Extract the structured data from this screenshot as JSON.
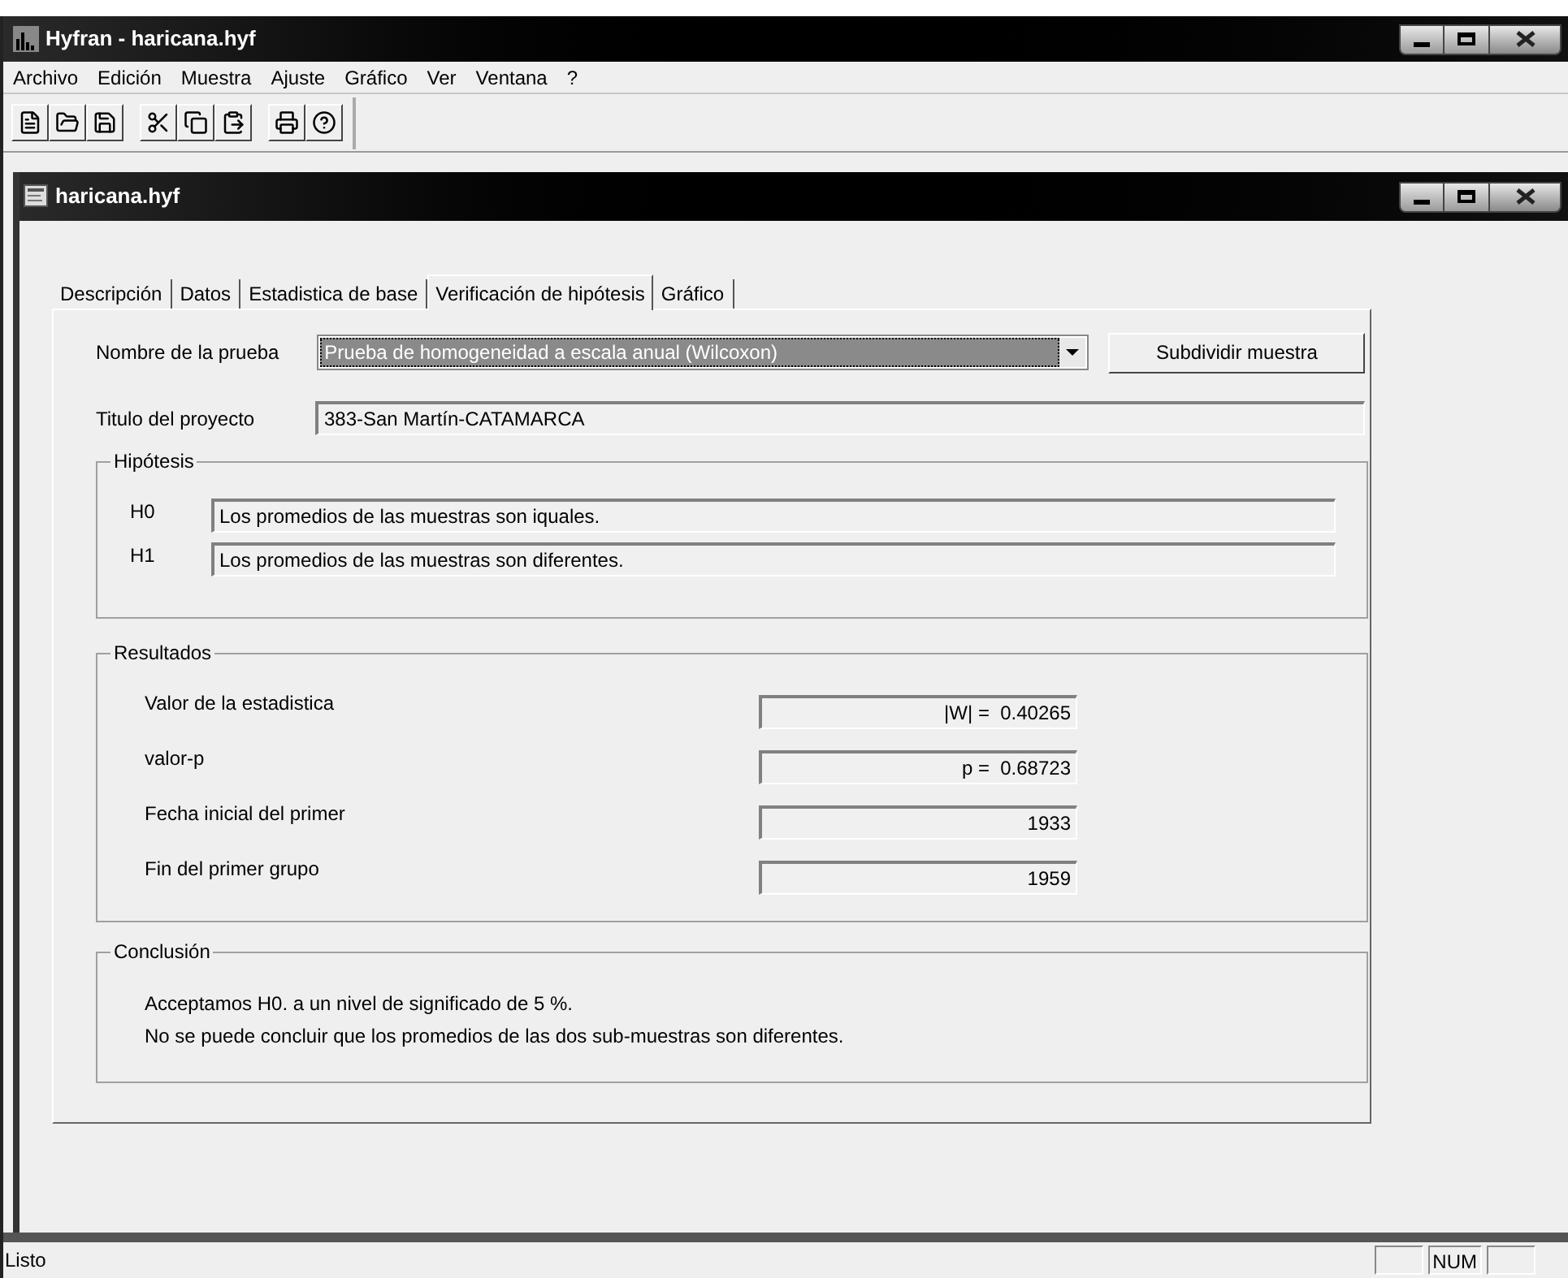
{
  "window": {
    "title": "Hyfran - haricana.hyf"
  },
  "menu": [
    "Archivo",
    "Edición",
    "Muestra",
    "Ajuste",
    "Gráfico",
    "Ver",
    "Ventana",
    "?"
  ],
  "toolbar": [
    [
      {
        "kind": "new"
      },
      {
        "kind": "open"
      },
      {
        "kind": "save"
      }
    ],
    [
      {
        "kind": "cut"
      },
      {
        "kind": "copy"
      },
      {
        "kind": "paste"
      }
    ],
    [
      {
        "kind": "print"
      },
      {
        "kind": "help"
      }
    ]
  ],
  "document": {
    "title": "haricana.hyf"
  },
  "tabs": [
    {
      "label": "Descripción",
      "selected": false
    },
    {
      "label": "Datos",
      "selected": false
    },
    {
      "label": "Estadistica de base",
      "selected": false
    },
    {
      "label": "Verificación de hipótesis",
      "selected": true
    },
    {
      "label": "Gráfico",
      "selected": false
    }
  ],
  "test": {
    "label": "Nombre de la prueba",
    "value": "Prueba de homogeneidad a escala anual (Wilcoxon)"
  },
  "subdivide_button": "Subdividir muestra",
  "project": {
    "label": "Titulo del proyecto",
    "value": "383-San Martín-CATAMARCA"
  },
  "hypotheses": {
    "title": "Hipótesis",
    "items": [
      {
        "label": "H0",
        "value": "Los promedios de las muestras son iquales."
      },
      {
        "label": "H1",
        "value": "Los promedios de las muestras son diferentes."
      }
    ]
  },
  "results": {
    "title": "Resultados",
    "items": [
      {
        "label": "Valor de la estadistica",
        "value": "|W| =  0.40265"
      },
      {
        "label": "valor-p",
        "value": "p =  0.68723"
      },
      {
        "label": "Fecha inicial del primer",
        "value": "1933"
      },
      {
        "label": "Fin del primer grupo",
        "value": "1959"
      }
    ]
  },
  "conclusion": {
    "title": "Conclusión",
    "lines": [
      "Acceptamos H0. a un nivel de significado de 5 %.",
      "No se puede concluir que los promedios de las dos sub-muestras son diferentes."
    ]
  },
  "status_bar": {
    "text": "Listo",
    "indicators": [
      "NUM"
    ]
  }
}
